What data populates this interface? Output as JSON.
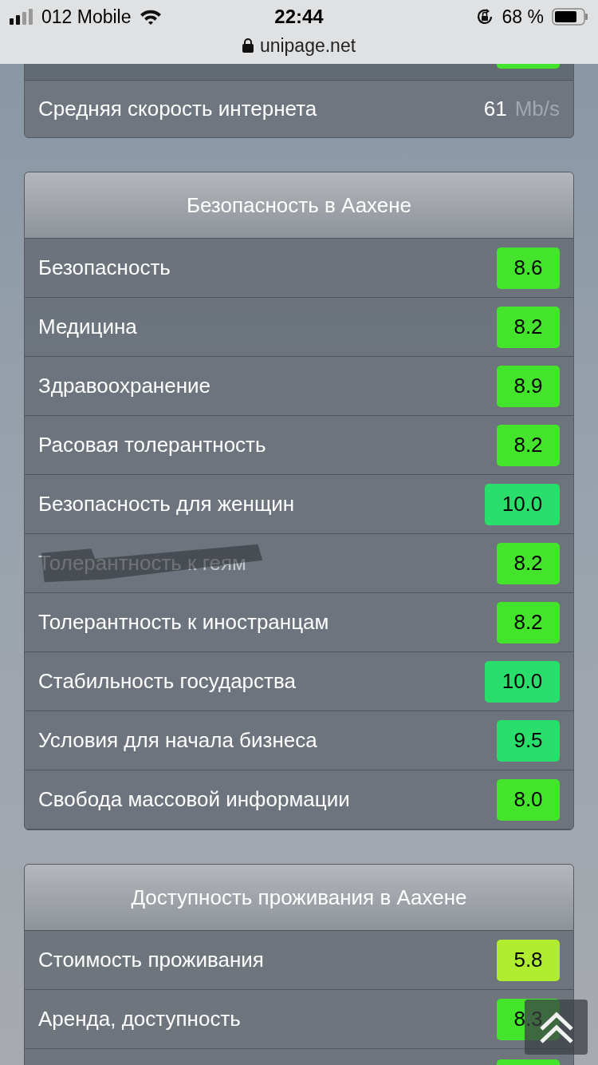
{
  "status_bar": {
    "carrier": "012 Mobile",
    "time": "22:44",
    "battery": "68 %",
    "url": "unipage.net"
  },
  "top_card": {
    "partial_badge": {
      "color": "#44e32c"
    },
    "rows": [
      {
        "label": "Средняя скорость интернета",
        "value": "61",
        "unit": "Mb/s"
      }
    ]
  },
  "sections": [
    {
      "title": "Безопасность в Аахене",
      "rows": [
        {
          "label": "Безопасность",
          "score": "8.6",
          "color": "#44e32c",
          "scribbled": false
        },
        {
          "label": "Медицина",
          "score": "8.2",
          "color": "#44e32c",
          "scribbled": false
        },
        {
          "label": "Здравоохранение",
          "score": "8.9",
          "color": "#44e32c",
          "scribbled": false
        },
        {
          "label": "Расовая толерантность",
          "score": "8.2",
          "color": "#44e32c",
          "scribbled": false
        },
        {
          "label": "Безопасность для женщин",
          "score": "10.0",
          "color": "#2ade6c",
          "scribbled": false
        },
        {
          "label": "Толерантность к геям",
          "score": "8.2",
          "color": "#44e32c",
          "scribbled": true
        },
        {
          "label": "Толерантность к иностранцам",
          "score": "8.2",
          "color": "#44e32c",
          "scribbled": false
        },
        {
          "label": "Стабильность государства",
          "score": "10.0",
          "color": "#2ade6c",
          "scribbled": false
        },
        {
          "label": "Условия для начала бизнеса",
          "score": "9.5",
          "color": "#2ade6c",
          "scribbled": false
        },
        {
          "label": "Свобода массовой информации",
          "score": "8.0",
          "color": "#44e32c",
          "scribbled": false
        }
      ]
    },
    {
      "title": "Доступность проживания в Аахене",
      "rows": [
        {
          "label": "Стоимость проживания",
          "score": "5.8",
          "color": "#b0ec30",
          "scribbled": false
        },
        {
          "label": "Аренда, доступность",
          "score": "8.3",
          "color": "#44e32c",
          "scribbled": false
        }
      ],
      "partial_badge": {
        "color": "#44e32c"
      }
    }
  ]
}
